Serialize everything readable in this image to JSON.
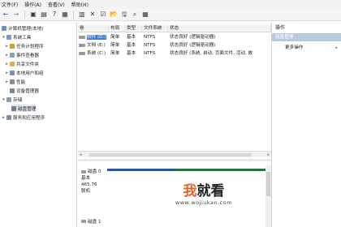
{
  "menu": [
    "文件(F)",
    "操作(A)",
    "查看(V)",
    "帮助(H)"
  ],
  "toolbar": {
    "back": "←",
    "forward": "→",
    "up": "▣",
    "show": "▤",
    "help": "?",
    "props": "▦",
    "refresh": "▥",
    "delete": "✕",
    "check": "☑",
    "open": "📂",
    "save": "🖫",
    "search": "⌕",
    "list": "▦"
  },
  "tree": {
    "root": "计算机管理(本地)",
    "system_tools": "系统工具",
    "task_scheduler": "任务计划程序",
    "event_viewer": "事件查看器",
    "shared_folders": "共享文件夹",
    "local_users": "本地用户和组",
    "performance": "性能",
    "device_manager": "设备管理器",
    "storage": "存储",
    "disk_management": "磁盘管理",
    "services": "服务和应用程序"
  },
  "table": {
    "headers": [
      "卷",
      "布局",
      "类型",
      "文件系统",
      "状态"
    ],
    "rows": [
      {
        "volume": "软件 (D:)",
        "layout": "简单",
        "type": "基本",
        "fs": "NTFS",
        "status": "状态良好 (逻辑驱动器)"
      },
      {
        "volume": "文档 (E:)",
        "layout": "简单",
        "type": "基本",
        "fs": "NTFS",
        "status": "状态良好 (逻辑驱动器)"
      },
      {
        "volume": "系统 (C:)",
        "layout": "简单",
        "type": "基本",
        "fs": "NTFS",
        "status": "状态良好 (系统, 启动, 页面文件, 活动, 故"
      }
    ]
  },
  "disk0": {
    "name": "磁盘 0",
    "type": "基本",
    "size": "465.76",
    "status": "联机"
  },
  "disk1": {
    "name": "磁盘 1"
  },
  "actions": {
    "title": "操作",
    "section": "磁盘管理",
    "more": "更多操作",
    "more_arrow": "▸"
  },
  "watermark": {
    "part1": "我",
    "part2": "就看",
    "url": "www.wojiukan.com"
  },
  "colors": {
    "selection": "#3a7bd5",
    "action_header": "#b9c9df",
    "partition_primary": "#2a56a8",
    "partition_logical": "#1e7a3c",
    "watermark_accent": "#e8632a"
  }
}
